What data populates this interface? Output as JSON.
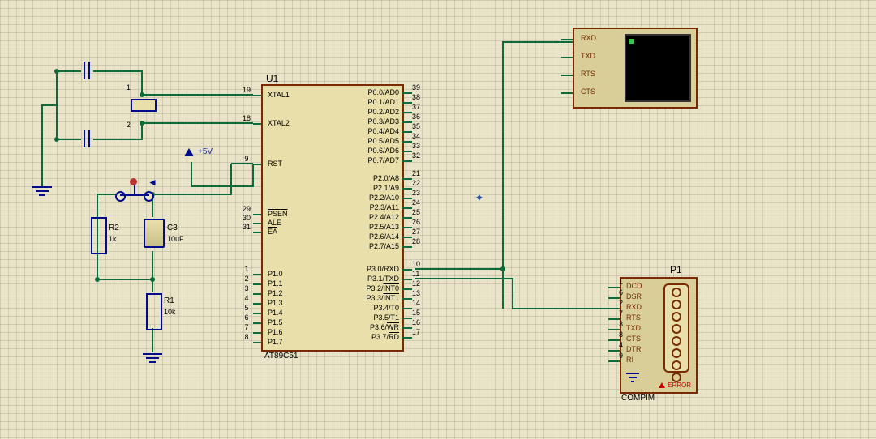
{
  "chip": {
    "ref": "U1",
    "model": "AT89C51",
    "left_pins": [
      {
        "num": "19",
        "name": "XTAL1"
      },
      {
        "num": "18",
        "name": "XTAL2"
      },
      {
        "num": "9",
        "name": "RST"
      },
      {
        "num": "29",
        "name": "PSEN",
        "over": true
      },
      {
        "num": "30",
        "name": "ALE"
      },
      {
        "num": "31",
        "name": "EA",
        "over": true
      },
      {
        "num": "1",
        "name": "P1.0"
      },
      {
        "num": "2",
        "name": "P1.1"
      },
      {
        "num": "3",
        "name": "P1.2"
      },
      {
        "num": "4",
        "name": "P1.3"
      },
      {
        "num": "5",
        "name": "P1.4"
      },
      {
        "num": "6",
        "name": "P1.5"
      },
      {
        "num": "7",
        "name": "P1.6"
      },
      {
        "num": "8",
        "name": "P1.7"
      }
    ],
    "right_pins": [
      {
        "num": "39",
        "name": "P0.0/AD0"
      },
      {
        "num": "38",
        "name": "P0.1/AD1"
      },
      {
        "num": "37",
        "name": "P0.2/AD2"
      },
      {
        "num": "36",
        "name": "P0.3/AD3"
      },
      {
        "num": "35",
        "name": "P0.4/AD4"
      },
      {
        "num": "34",
        "name": "P0.5/AD5"
      },
      {
        "num": "33",
        "name": "P0.6/AD6"
      },
      {
        "num": "32",
        "name": "P0.7/AD7"
      },
      {
        "num": "21",
        "name": "P2.0/A8"
      },
      {
        "num": "22",
        "name": "P2.1/A9"
      },
      {
        "num": "23",
        "name": "P2.2/A10"
      },
      {
        "num": "24",
        "name": "P2.3/A11"
      },
      {
        "num": "25",
        "name": "P2.4/A12"
      },
      {
        "num": "26",
        "name": "P2.5/A13"
      },
      {
        "num": "27",
        "name": "P2.6/A14"
      },
      {
        "num": "28",
        "name": "P2.7/A15"
      },
      {
        "num": "10",
        "name": "P3.0/RXD"
      },
      {
        "num": "11",
        "name": "P3.1/TXD"
      },
      {
        "num": "12",
        "name": "P3.2/INT0",
        "over": "INT0"
      },
      {
        "num": "13",
        "name": "P3.3/INT1",
        "over": "INT1"
      },
      {
        "num": "14",
        "name": "P3.4/T0"
      },
      {
        "num": "15",
        "name": "P3.5/T1"
      },
      {
        "num": "16",
        "name": "P3.6/WR",
        "over": "WR"
      },
      {
        "num": "17",
        "name": "P3.7/RD",
        "over": "RD"
      }
    ]
  },
  "components": {
    "r1": {
      "ref": "R1",
      "value": "10k"
    },
    "r2": {
      "ref": "R2",
      "value": "1k"
    },
    "c3": {
      "ref": "C3",
      "value": "10uF"
    },
    "vcc_label": "+5V"
  },
  "vterm": {
    "pins": [
      "RXD",
      "TXD",
      "RTS",
      "CTS"
    ]
  },
  "db9": {
    "ref": "P1",
    "model": "COMPIM",
    "error": "ERROR",
    "pins": [
      {
        "num": "1",
        "name": "DCD"
      },
      {
        "num": "6",
        "name": "DSR"
      },
      {
        "num": "2",
        "name": "RXD"
      },
      {
        "num": "7",
        "name": "RTS"
      },
      {
        "num": "3",
        "name": "TXD"
      },
      {
        "num": "8",
        "name": "CTS"
      },
      {
        "num": "4",
        "name": "DTR"
      },
      {
        "num": "9",
        "name": "RI"
      }
    ]
  }
}
